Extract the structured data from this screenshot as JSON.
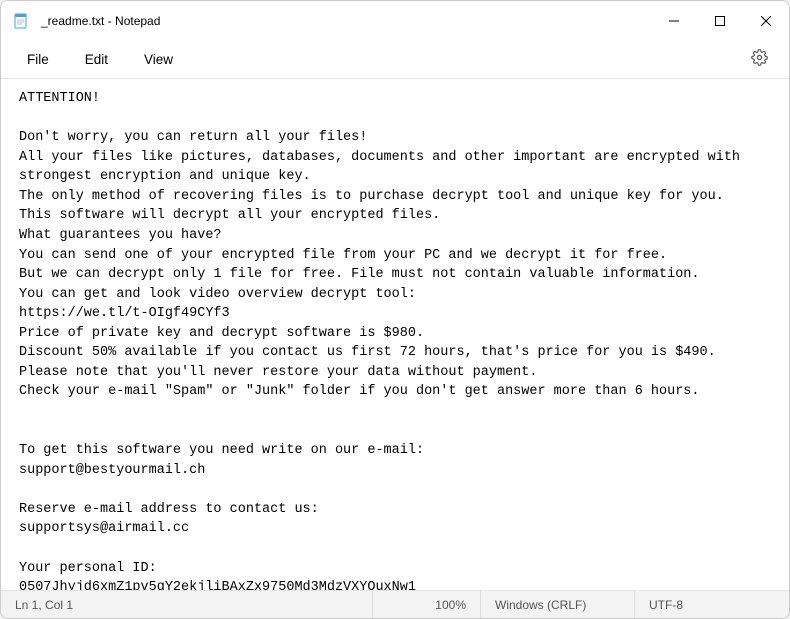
{
  "titlebar": {
    "title": "_readme.txt - Notepad"
  },
  "menubar": {
    "file": "File",
    "edit": "Edit",
    "view": "View"
  },
  "document": {
    "content": "ATTENTION!\n\nDon't worry, you can return all your files!\nAll your files like pictures, databases, documents and other important are encrypted with strongest encryption and unique key.\nThe only method of recovering files is to purchase decrypt tool and unique key for you.\nThis software will decrypt all your encrypted files.\nWhat guarantees you have?\nYou can send one of your encrypted file from your PC and we decrypt it for free.\nBut we can decrypt only 1 file for free. File must not contain valuable information.\nYou can get and look video overview decrypt tool:\nhttps://we.tl/t-OIgf49CYf3\nPrice of private key and decrypt software is $980.\nDiscount 50% available if you contact us first 72 hours, that's price for you is $490.\nPlease note that you'll never restore your data without payment.\nCheck your e-mail \"Spam\" or \"Junk\" folder if you don't get answer more than 6 hours.\n\n\nTo get this software you need write on our e-mail:\nsupport@bestyourmail.ch\n\nReserve e-mail address to contact us:\nsupportsys@airmail.cc\n\nYour personal ID:\n0507Jhyjd6xmZ1pv5qY2ekjliBAxZx9750Md3MdzVXYOuxNw1"
  },
  "statusbar": {
    "cursor": "Ln 1, Col 1",
    "zoom": "100%",
    "eol": "Windows (CRLF)",
    "encoding": "UTF-8"
  }
}
